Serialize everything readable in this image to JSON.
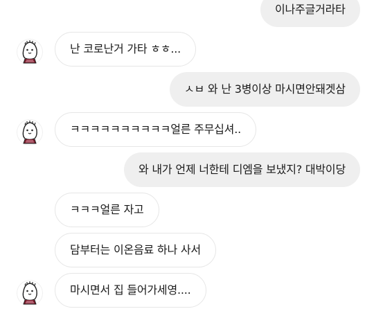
{
  "conversation": {
    "messages": [
      {
        "id": "m1",
        "direction": "out",
        "text": "이나주글거라타"
      },
      {
        "id": "m2",
        "direction": "in",
        "text": "난 코로난거 가타 ㅎㅎ...",
        "has_avatar": true
      },
      {
        "id": "m3",
        "direction": "out",
        "text": "ㅅㅂ 와 난 3병이상 마시면안돼겟삼"
      },
      {
        "id": "m4",
        "direction": "in",
        "text": "ㅋㅋㅋㅋㅋㅋㅋㅋㅋㅋ얼른 주무십셔..",
        "has_avatar": true
      },
      {
        "id": "m5",
        "direction": "out",
        "text": "와 내가 언제 너한테 디엠을 보냈지? 대박이당"
      },
      {
        "id": "m6",
        "direction": "in",
        "text": "ㅋㅋㅋ얼른 자고",
        "has_avatar": false
      },
      {
        "id": "m7",
        "direction": "in",
        "text": "담부터는 이온음료 하나 사서",
        "has_avatar": false
      },
      {
        "id": "m8",
        "direction": "in",
        "text": "마시면서 집 들어가세영....",
        "has_avatar": true
      }
    ]
  },
  "avatar": {
    "icon": "cartoon-character-icon"
  },
  "colors": {
    "outgoing_bubble": "#efefef",
    "incoming_bubble_border": "#e6e6e6",
    "text": "#1a1a1a",
    "background": "#ffffff"
  }
}
